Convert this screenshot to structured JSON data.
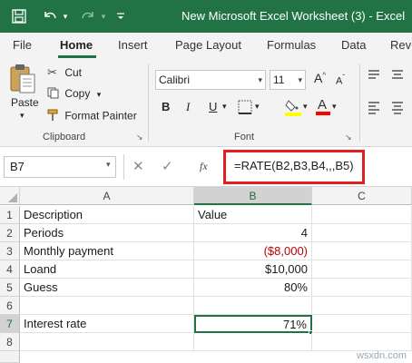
{
  "window": {
    "title": "New Microsoft Excel Worksheet (3)  -  Excel"
  },
  "tabs": [
    "File",
    "Home",
    "Insert",
    "Page Layout",
    "Formulas",
    "Data",
    "Review"
  ],
  "active_tab": "Home",
  "ribbon": {
    "clipboard": {
      "paste": "Paste",
      "cut": "Cut",
      "copy": "Copy",
      "format_painter": "Format Painter",
      "group_label": "Clipboard"
    },
    "font": {
      "font_name": "Calibri",
      "font_size": "11",
      "bold": "B",
      "italic": "I",
      "underline": "U",
      "group_label": "Font",
      "fill_color": "#ffff00",
      "font_color": "#ff0000"
    }
  },
  "formula_bar": {
    "name_box": "B7",
    "fx": "fx",
    "formula": "=RATE(B2,B3,B4,,,B5)"
  },
  "grid": {
    "columns": [
      "A",
      "B",
      "C"
    ],
    "rows": [
      {
        "num": "1",
        "a": "Description",
        "b": "Value"
      },
      {
        "num": "2",
        "a": "Periods",
        "b": "4"
      },
      {
        "num": "3",
        "a": "Monthly payment",
        "b": "($8,000)"
      },
      {
        "num": "4",
        "a": "Loand",
        "b": "$10,000"
      },
      {
        "num": "5",
        "a": "Guess",
        "b": "80%"
      },
      {
        "num": "6",
        "a": "",
        "b": ""
      },
      {
        "num": "7",
        "a": "Interest rate",
        "b": "71%"
      },
      {
        "num": "8",
        "a": "",
        "b": ""
      }
    ]
  },
  "watermark": "wsxdn.com",
  "colors": {
    "accent": "#217346",
    "highlight_box": "#e02020",
    "negative": "#c00000"
  }
}
